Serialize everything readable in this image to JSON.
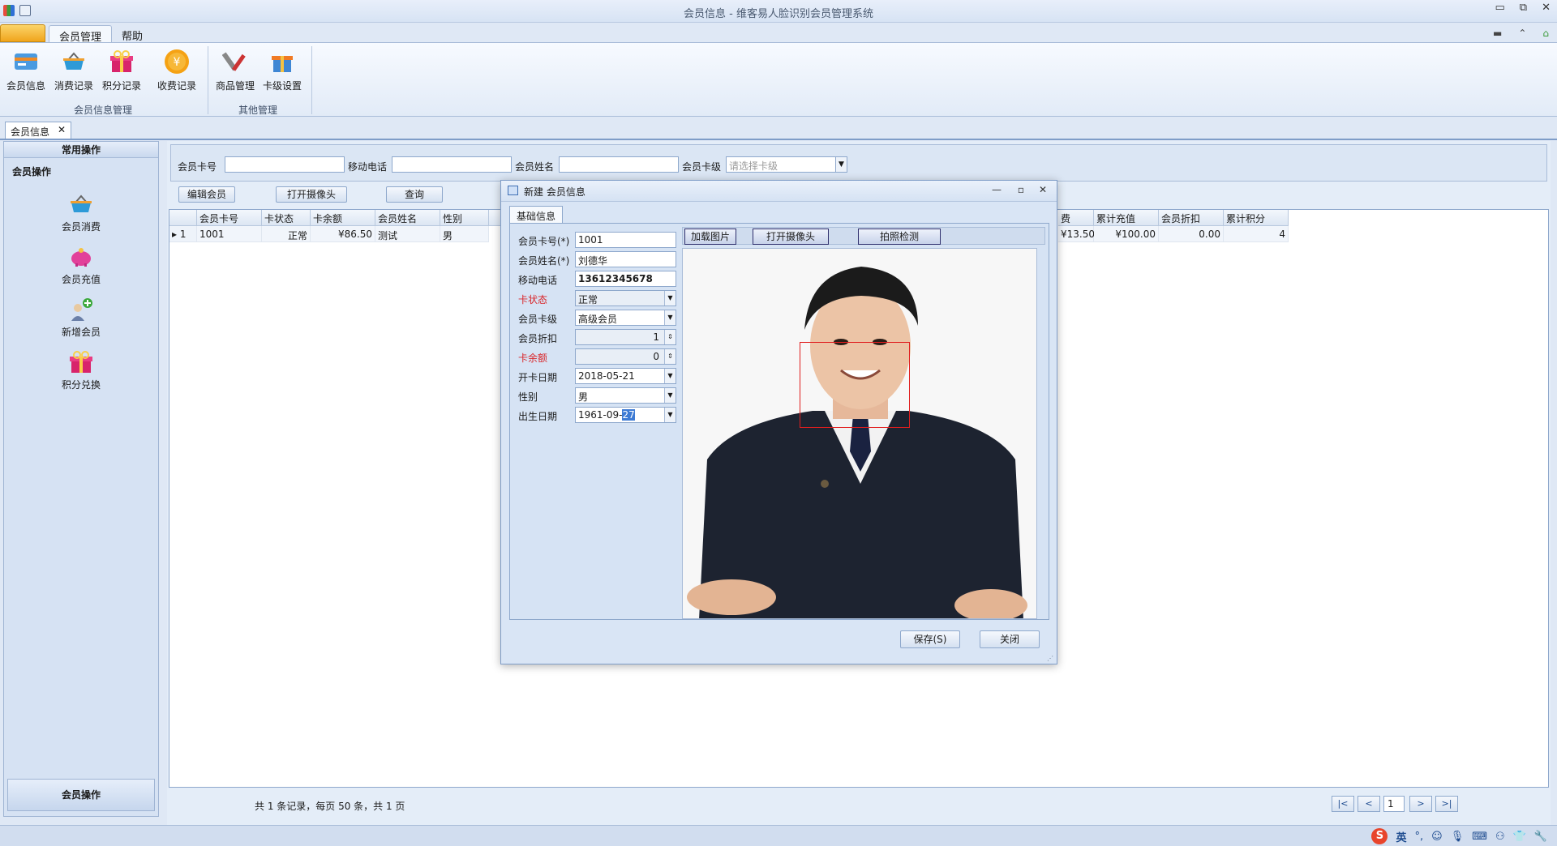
{
  "window": {
    "title": "会员信息 - 维客易人脸识别会员管理系统"
  },
  "ribbon": {
    "tabs": [
      "会员管理",
      "帮助"
    ],
    "groups": [
      {
        "label": "会员信息管理",
        "buttons": [
          "会员信息",
          "消费记录",
          "积分记录",
          "收费记录"
        ]
      },
      {
        "label": "其他管理",
        "buttons": [
          "商品管理",
          "卡级设置"
        ]
      }
    ]
  },
  "doc_tab": {
    "label": "会员信息",
    "close": "✕"
  },
  "left_panel": {
    "header": "常用操作",
    "section": "会员操作",
    "items": [
      "会员消费",
      "会员充值",
      "新增会员",
      "积分兑换"
    ],
    "footer": "会员操作"
  },
  "search": {
    "card_no_label": "会员卡号",
    "phone_label": "移动电话",
    "name_label": "会员姓名",
    "level_label": "会员卡级",
    "level_placeholder": "请选择卡级"
  },
  "toolbar": {
    "edit": "编辑会员",
    "camera": "打开摄像头",
    "query": "查询"
  },
  "grid": {
    "headers": [
      "会员卡号",
      "卡状态",
      "卡余额",
      "会员姓名",
      "性别",
      "费",
      "累计充值",
      "会员折扣",
      "累计积分"
    ],
    "rows": [
      {
        "index": "1",
        "card_no": "1001",
        "status": "正常",
        "balance": "¥86.50",
        "name": "测试",
        "gender": "男",
        "consumed": "¥13.50",
        "recharge": "¥100.00",
        "discount": "0.00",
        "points": "4"
      }
    ]
  },
  "pager": {
    "info": "共 1 条记录，每页 50 条，共 1 页",
    "first": "|<",
    "prev": "<",
    "page": "1",
    "next": ">",
    "last": ">|"
  },
  "dialog": {
    "title": "新建 会员信息",
    "tab": "基础信息",
    "fields": {
      "card_no": {
        "label": "会员卡号(*)",
        "value": "1001"
      },
      "name": {
        "label": "会员姓名(*)",
        "value": "刘德华"
      },
      "phone": {
        "label": "移动电话",
        "value": "13612345678"
      },
      "status": {
        "label": "卡状态",
        "value": "正常"
      },
      "level": {
        "label": "会员卡级",
        "value": "高级会员"
      },
      "discount": {
        "label": "会员折扣",
        "value": "1"
      },
      "balance": {
        "label": "卡余额",
        "value": "0"
      },
      "open_date": {
        "label": "开卡日期",
        "value": "2018-05-21"
      },
      "gender": {
        "label": "性别",
        "value": "男"
      },
      "birth": {
        "label": "出生日期",
        "value_prefix": "1961-09-",
        "value_selected": "27"
      }
    },
    "image_buttons": [
      "加载图片",
      "打开摄像头",
      "拍照检测"
    ],
    "save": "保存(S)",
    "close": "关闭"
  },
  "tray": {
    "ime_logo": "S",
    "ime_lang": "英"
  },
  "colors": {
    "accent": "#3e7bd4",
    "required_red": "#d9262a",
    "face_box": "#e01e1e"
  }
}
